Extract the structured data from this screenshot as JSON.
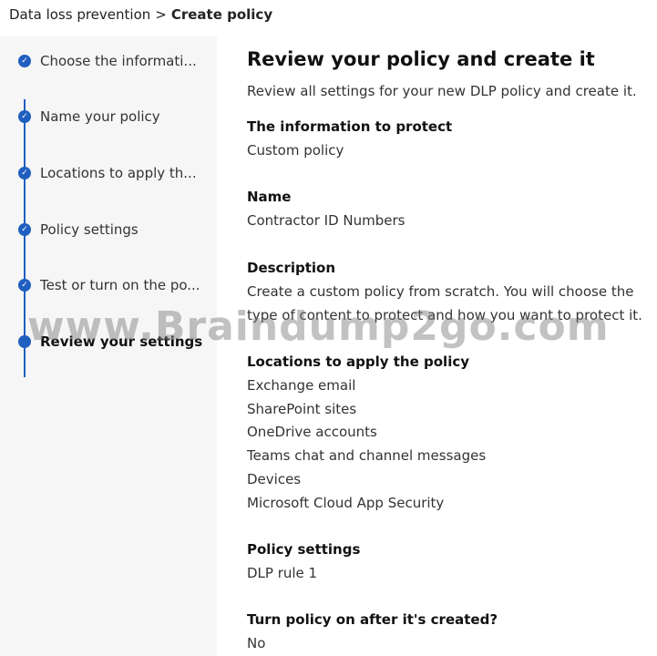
{
  "breadcrumb": {
    "parent": "Data loss prevention",
    "separator": ">",
    "current": "Create policy"
  },
  "steps": [
    {
      "label": "Choose the informati...",
      "status": "done"
    },
    {
      "label": "Name your policy",
      "status": "done"
    },
    {
      "label": "Locations to apply th...",
      "status": "done"
    },
    {
      "label": "Policy settings",
      "status": "done"
    },
    {
      "label": "Test or turn on the po...",
      "status": "done"
    },
    {
      "label": "Review your settings",
      "status": "current"
    }
  ],
  "review": {
    "title": "Review your policy and create it",
    "intro": "Review all settings for your new DLP policy and create it.",
    "info_heading": "The information to protect",
    "info_value": "Custom policy",
    "name_heading": "Name",
    "name_value": "Contractor ID Numbers",
    "desc_heading": "Description",
    "desc_line1": "Create a custom policy from scratch. You will choose the",
    "desc_line2": "type of content to protect and how you want to protect it.",
    "locations_heading": "Locations to apply the policy",
    "locations": [
      "Exchange email",
      "SharePoint sites",
      "OneDrive accounts",
      "Teams chat and channel messages",
      "Devices",
      "Microsoft Cloud App Security"
    ],
    "settings_heading": "Policy settings",
    "settings_value": "DLP rule 1",
    "turn_on_heading": "Turn policy on after it's created?",
    "turn_on_value": "No"
  },
  "watermark": "www.Braindump2go.com",
  "colors": {
    "accent": "#1f5fbf",
    "sidebar_bg": "#f6f6f6"
  }
}
